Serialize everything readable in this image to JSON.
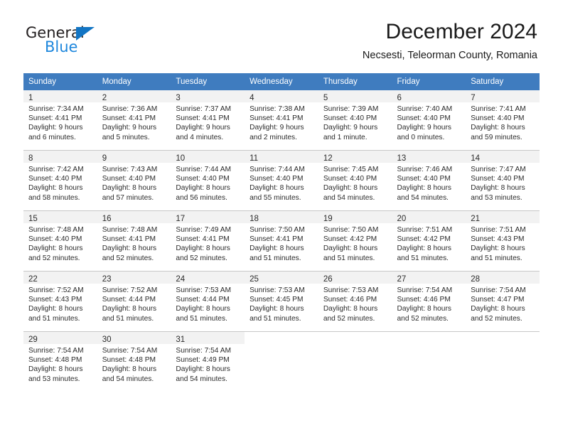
{
  "brand": {
    "name_dark": "General",
    "name_blue": "Blue",
    "triangle_color": "#1275c4",
    "blue_color": "#1e87dd"
  },
  "header": {
    "month_title": "December 2024",
    "location": "Necsesti, Teleorman County, Romania"
  },
  "theme": {
    "header_row_bg": "#3f7cbf",
    "header_row_text": "#ffffff",
    "shaded_day_bg": "#f2f2f2",
    "row_separator": "#c8c8c8"
  },
  "weekday_headers": [
    "Sunday",
    "Monday",
    "Tuesday",
    "Wednesday",
    "Thursday",
    "Friday",
    "Saturday"
  ],
  "weeks": [
    [
      {
        "day": "1",
        "sunrise": "Sunrise: 7:34 AM",
        "sunset": "Sunset: 4:41 PM",
        "daylight_1": "Daylight: 9 hours",
        "daylight_2": "and 6 minutes."
      },
      {
        "day": "2",
        "sunrise": "Sunrise: 7:36 AM",
        "sunset": "Sunset: 4:41 PM",
        "daylight_1": "Daylight: 9 hours",
        "daylight_2": "and 5 minutes."
      },
      {
        "day": "3",
        "sunrise": "Sunrise: 7:37 AM",
        "sunset": "Sunset: 4:41 PM",
        "daylight_1": "Daylight: 9 hours",
        "daylight_2": "and 4 minutes."
      },
      {
        "day": "4",
        "sunrise": "Sunrise: 7:38 AM",
        "sunset": "Sunset: 4:41 PM",
        "daylight_1": "Daylight: 9 hours",
        "daylight_2": "and 2 minutes."
      },
      {
        "day": "5",
        "sunrise": "Sunrise: 7:39 AM",
        "sunset": "Sunset: 4:40 PM",
        "daylight_1": "Daylight: 9 hours",
        "daylight_2": "and 1 minute."
      },
      {
        "day": "6",
        "sunrise": "Sunrise: 7:40 AM",
        "sunset": "Sunset: 4:40 PM",
        "daylight_1": "Daylight: 9 hours",
        "daylight_2": "and 0 minutes."
      },
      {
        "day": "7",
        "sunrise": "Sunrise: 7:41 AM",
        "sunset": "Sunset: 4:40 PM",
        "daylight_1": "Daylight: 8 hours",
        "daylight_2": "and 59 minutes."
      }
    ],
    [
      {
        "day": "8",
        "sunrise": "Sunrise: 7:42 AM",
        "sunset": "Sunset: 4:40 PM",
        "daylight_1": "Daylight: 8 hours",
        "daylight_2": "and 58 minutes."
      },
      {
        "day": "9",
        "sunrise": "Sunrise: 7:43 AM",
        "sunset": "Sunset: 4:40 PM",
        "daylight_1": "Daylight: 8 hours",
        "daylight_2": "and 57 minutes."
      },
      {
        "day": "10",
        "sunrise": "Sunrise: 7:44 AM",
        "sunset": "Sunset: 4:40 PM",
        "daylight_1": "Daylight: 8 hours",
        "daylight_2": "and 56 minutes."
      },
      {
        "day": "11",
        "sunrise": "Sunrise: 7:44 AM",
        "sunset": "Sunset: 4:40 PM",
        "daylight_1": "Daylight: 8 hours",
        "daylight_2": "and 55 minutes."
      },
      {
        "day": "12",
        "sunrise": "Sunrise: 7:45 AM",
        "sunset": "Sunset: 4:40 PM",
        "daylight_1": "Daylight: 8 hours",
        "daylight_2": "and 54 minutes."
      },
      {
        "day": "13",
        "sunrise": "Sunrise: 7:46 AM",
        "sunset": "Sunset: 4:40 PM",
        "daylight_1": "Daylight: 8 hours",
        "daylight_2": "and 54 minutes."
      },
      {
        "day": "14",
        "sunrise": "Sunrise: 7:47 AM",
        "sunset": "Sunset: 4:40 PM",
        "daylight_1": "Daylight: 8 hours",
        "daylight_2": "and 53 minutes."
      }
    ],
    [
      {
        "day": "15",
        "sunrise": "Sunrise: 7:48 AM",
        "sunset": "Sunset: 4:40 PM",
        "daylight_1": "Daylight: 8 hours",
        "daylight_2": "and 52 minutes."
      },
      {
        "day": "16",
        "sunrise": "Sunrise: 7:48 AM",
        "sunset": "Sunset: 4:41 PM",
        "daylight_1": "Daylight: 8 hours",
        "daylight_2": "and 52 minutes."
      },
      {
        "day": "17",
        "sunrise": "Sunrise: 7:49 AM",
        "sunset": "Sunset: 4:41 PM",
        "daylight_1": "Daylight: 8 hours",
        "daylight_2": "and 52 minutes."
      },
      {
        "day": "18",
        "sunrise": "Sunrise: 7:50 AM",
        "sunset": "Sunset: 4:41 PM",
        "daylight_1": "Daylight: 8 hours",
        "daylight_2": "and 51 minutes."
      },
      {
        "day": "19",
        "sunrise": "Sunrise: 7:50 AM",
        "sunset": "Sunset: 4:42 PM",
        "daylight_1": "Daylight: 8 hours",
        "daylight_2": "and 51 minutes."
      },
      {
        "day": "20",
        "sunrise": "Sunrise: 7:51 AM",
        "sunset": "Sunset: 4:42 PM",
        "daylight_1": "Daylight: 8 hours",
        "daylight_2": "and 51 minutes."
      },
      {
        "day": "21",
        "sunrise": "Sunrise: 7:51 AM",
        "sunset": "Sunset: 4:43 PM",
        "daylight_1": "Daylight: 8 hours",
        "daylight_2": "and 51 minutes."
      }
    ],
    [
      {
        "day": "22",
        "sunrise": "Sunrise: 7:52 AM",
        "sunset": "Sunset: 4:43 PM",
        "daylight_1": "Daylight: 8 hours",
        "daylight_2": "and 51 minutes."
      },
      {
        "day": "23",
        "sunrise": "Sunrise: 7:52 AM",
        "sunset": "Sunset: 4:44 PM",
        "daylight_1": "Daylight: 8 hours",
        "daylight_2": "and 51 minutes."
      },
      {
        "day": "24",
        "sunrise": "Sunrise: 7:53 AM",
        "sunset": "Sunset: 4:44 PM",
        "daylight_1": "Daylight: 8 hours",
        "daylight_2": "and 51 minutes."
      },
      {
        "day": "25",
        "sunrise": "Sunrise: 7:53 AM",
        "sunset": "Sunset: 4:45 PM",
        "daylight_1": "Daylight: 8 hours",
        "daylight_2": "and 51 minutes."
      },
      {
        "day": "26",
        "sunrise": "Sunrise: 7:53 AM",
        "sunset": "Sunset: 4:46 PM",
        "daylight_1": "Daylight: 8 hours",
        "daylight_2": "and 52 minutes."
      },
      {
        "day": "27",
        "sunrise": "Sunrise: 7:54 AM",
        "sunset": "Sunset: 4:46 PM",
        "daylight_1": "Daylight: 8 hours",
        "daylight_2": "and 52 minutes."
      },
      {
        "day": "28",
        "sunrise": "Sunrise: 7:54 AM",
        "sunset": "Sunset: 4:47 PM",
        "daylight_1": "Daylight: 8 hours",
        "daylight_2": "and 52 minutes."
      }
    ],
    [
      {
        "day": "29",
        "sunrise": "Sunrise: 7:54 AM",
        "sunset": "Sunset: 4:48 PM",
        "daylight_1": "Daylight: 8 hours",
        "daylight_2": "and 53 minutes."
      },
      {
        "day": "30",
        "sunrise": "Sunrise: 7:54 AM",
        "sunset": "Sunset: 4:48 PM",
        "daylight_1": "Daylight: 8 hours",
        "daylight_2": "and 54 minutes."
      },
      {
        "day": "31",
        "sunrise": "Sunrise: 7:54 AM",
        "sunset": "Sunset: 4:49 PM",
        "daylight_1": "Daylight: 8 hours",
        "daylight_2": "and 54 minutes."
      },
      null,
      null,
      null,
      null
    ]
  ]
}
